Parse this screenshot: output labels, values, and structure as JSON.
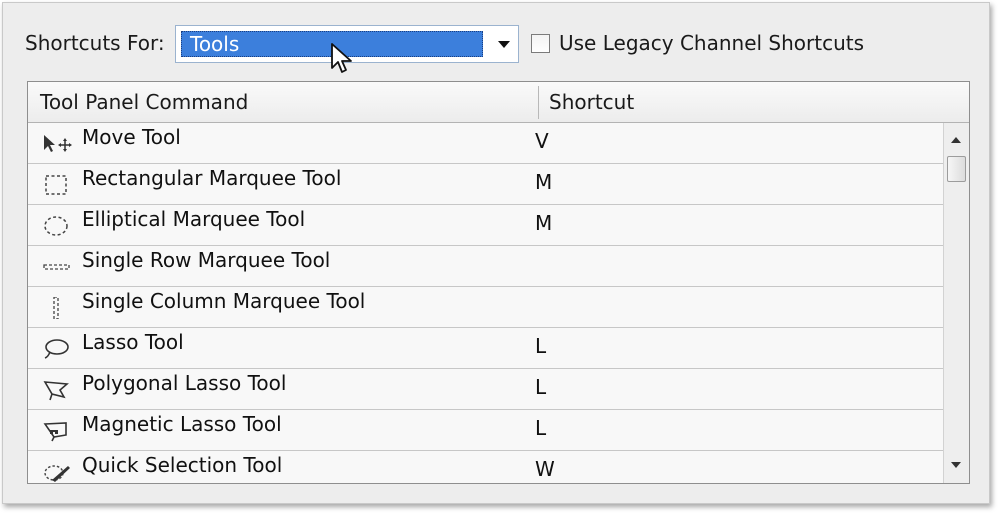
{
  "shortcuts_for": {
    "label": "Shortcuts For:",
    "selected": "Tools"
  },
  "legacy": {
    "label": "Use Legacy Channel Shortcuts",
    "checked": false
  },
  "table": {
    "headers": [
      "Tool Panel Command",
      "Shortcut"
    ],
    "rows": [
      {
        "icon": "move-tool-icon",
        "command": "Move Tool",
        "shortcut": "V"
      },
      {
        "icon": "rectangular-marquee-icon",
        "command": "Rectangular Marquee Tool",
        "shortcut": "M"
      },
      {
        "icon": "elliptical-marquee-icon",
        "command": "Elliptical Marquee Tool",
        "shortcut": "M"
      },
      {
        "icon": "single-row-marquee-icon",
        "command": "Single Row Marquee Tool",
        "shortcut": ""
      },
      {
        "icon": "single-column-marquee-icon",
        "command": "Single Column Marquee Tool",
        "shortcut": ""
      },
      {
        "icon": "lasso-icon",
        "command": "Lasso Tool",
        "shortcut": "L"
      },
      {
        "icon": "polygonal-lasso-icon",
        "command": "Polygonal Lasso Tool",
        "shortcut": "L"
      },
      {
        "icon": "magnetic-lasso-icon",
        "command": "Magnetic Lasso Tool",
        "shortcut": "L"
      },
      {
        "icon": "quick-selection-icon",
        "command": "Quick Selection Tool",
        "shortcut": "W"
      }
    ]
  },
  "colors": {
    "selection": "#3c7fdc",
    "panel": "#ededed"
  }
}
